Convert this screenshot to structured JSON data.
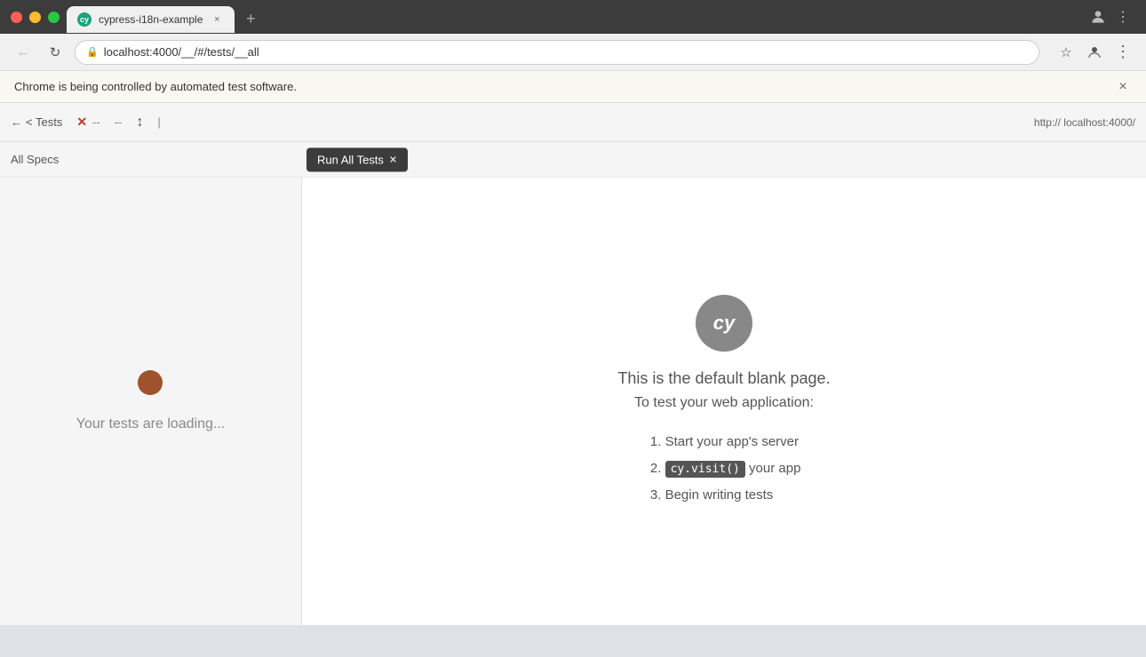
{
  "browser": {
    "tab_title": "cypress-i18n-example",
    "url": "localhost:4000/__/#/tests/__all",
    "new_tab_label": "+",
    "close_label": "×"
  },
  "automation_banner": {
    "text": "Chrome is being controlled by automated test software.",
    "close_label": "×"
  },
  "cypress_toolbar": {
    "back_label": "< Tests",
    "status_x": "✕",
    "status_dash1": "--",
    "status_dash2": "--",
    "arrow_label": "↕",
    "pipe_label": "|",
    "url_label": "http:// localhost:4000/"
  },
  "cypress_subbar": {
    "specs_label": "All Specs",
    "run_all_label": "Run All Tests",
    "run_icon": "✕"
  },
  "tests_pane": {
    "loading_text": "Your tests are loading..."
  },
  "preview_pane": {
    "logo_text": "cy",
    "title_line1": "This is the default blank page.",
    "title_line2": "To test your web application:",
    "step1": "Start your app's server",
    "step2_prefix": "",
    "step2_code": "cy.visit()",
    "step2_suffix": " your app",
    "step3": "Begin writing tests"
  }
}
